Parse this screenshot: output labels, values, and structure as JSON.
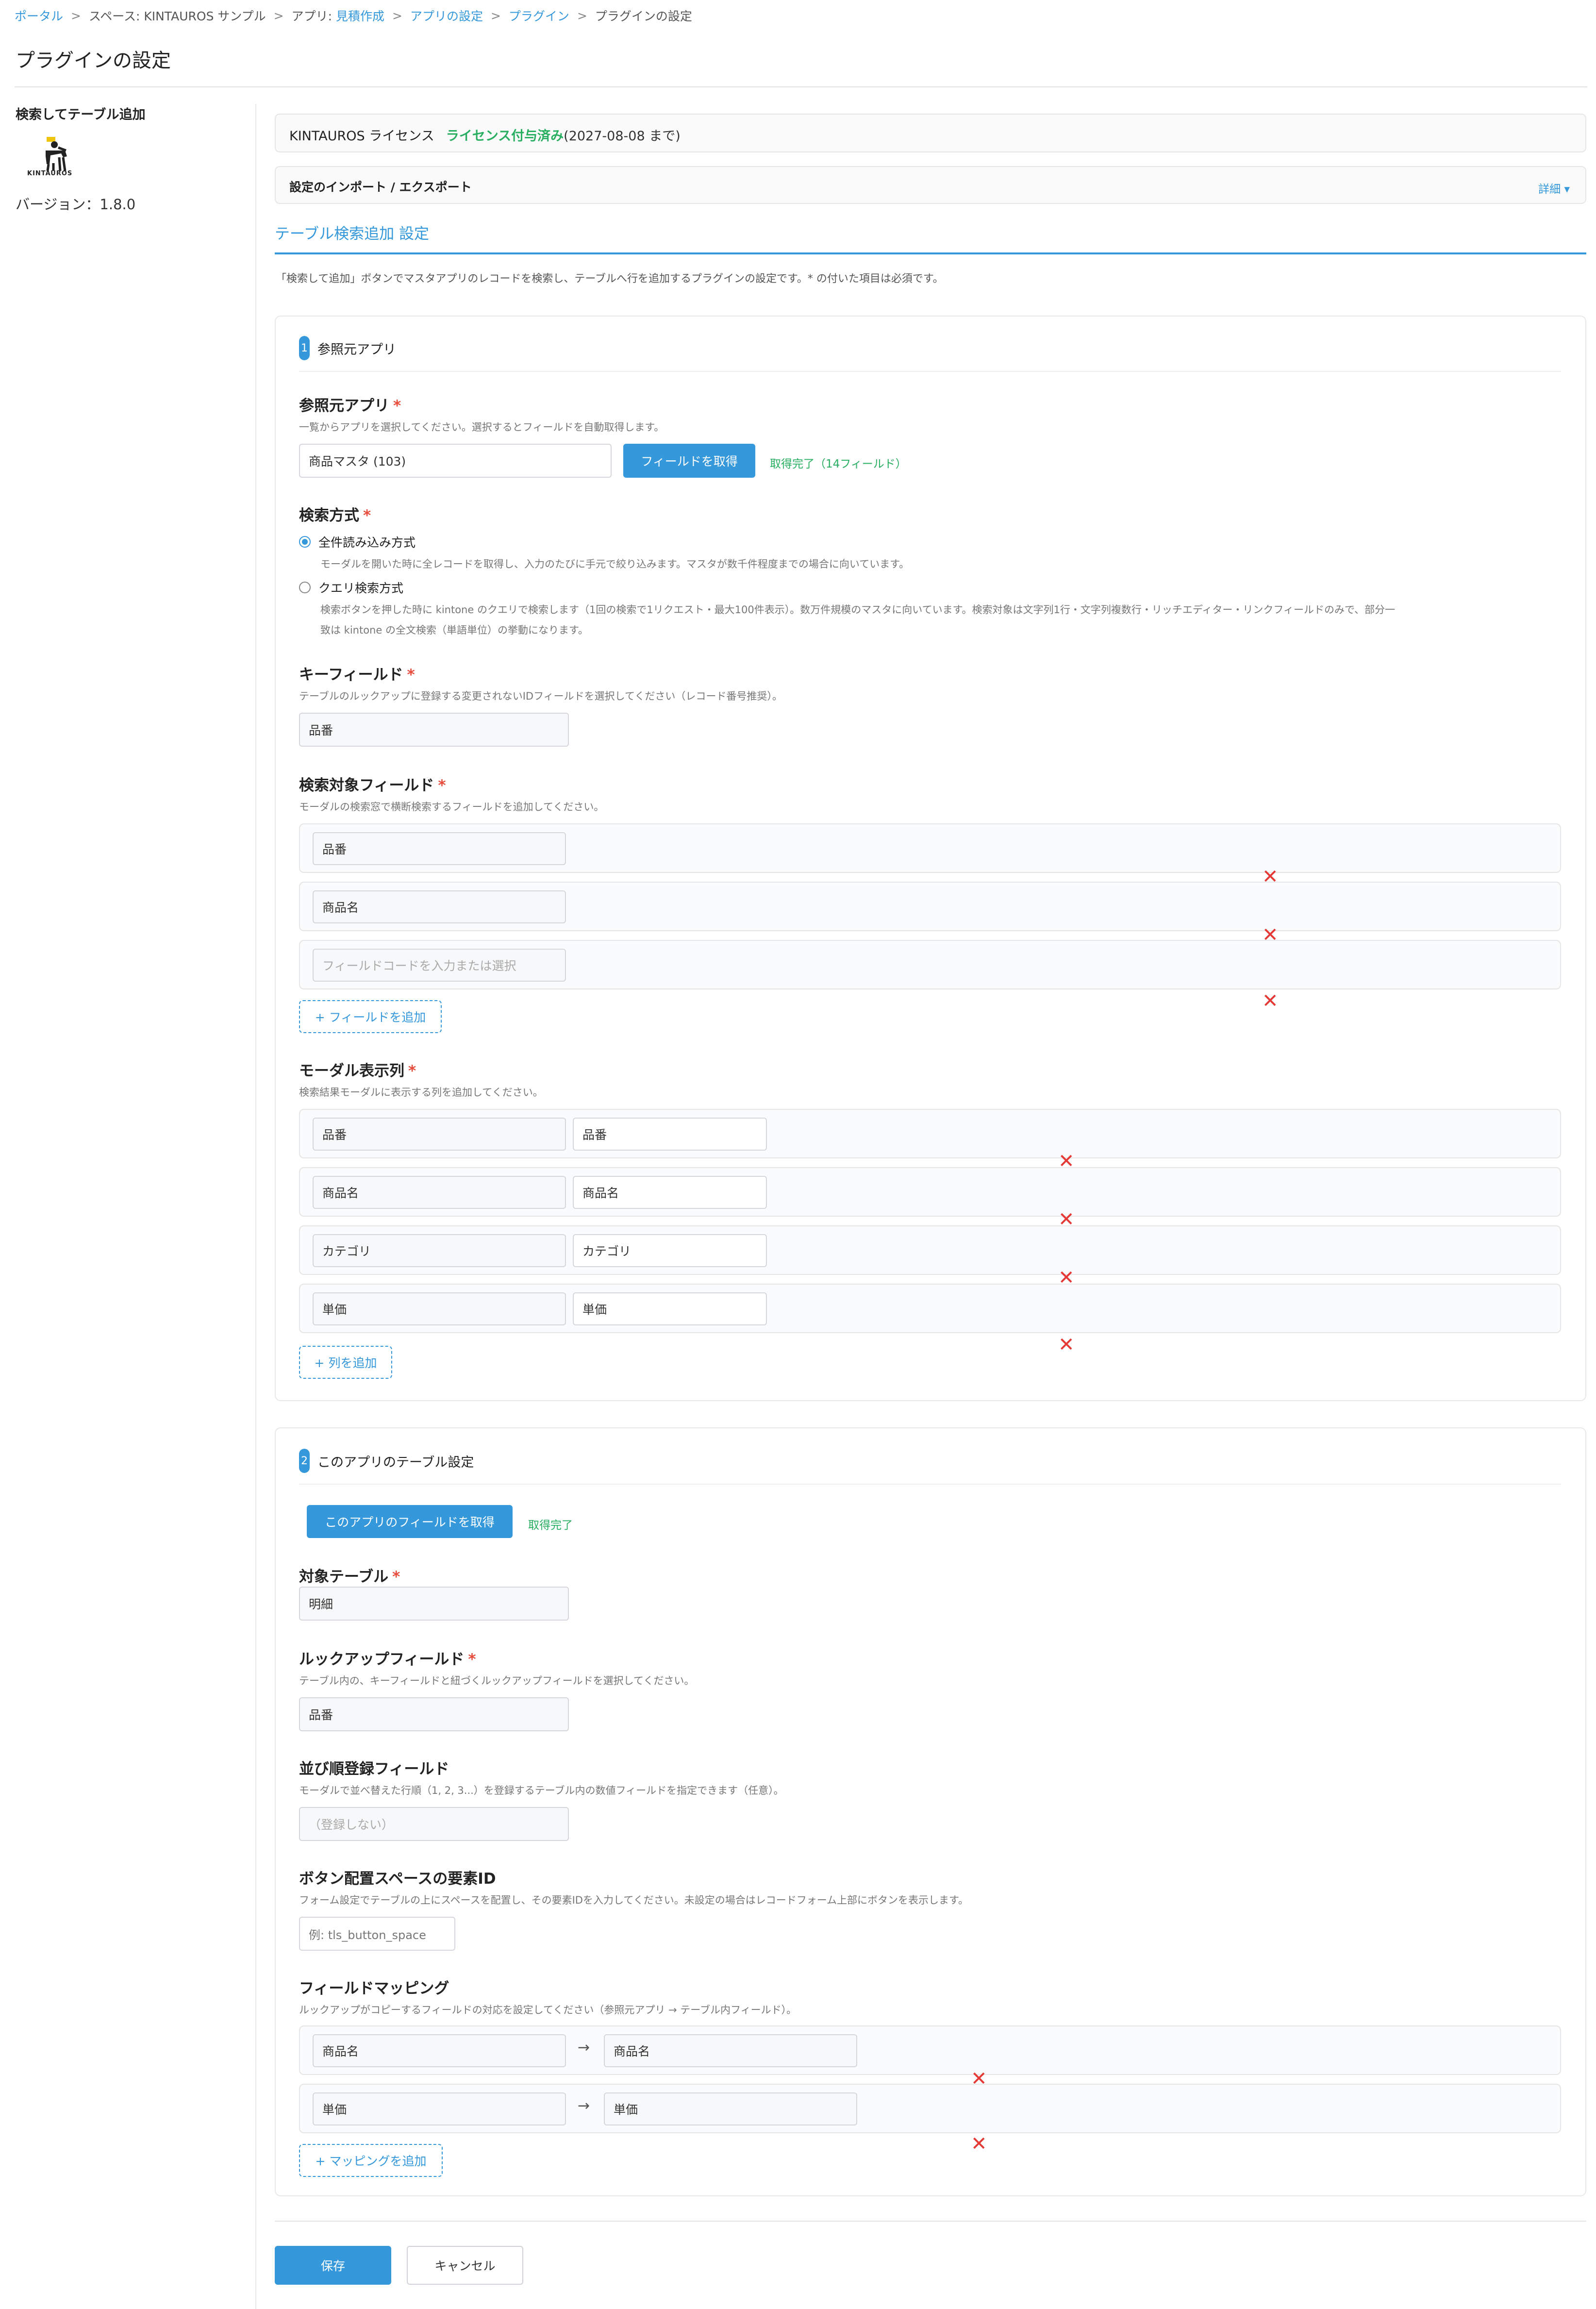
{
  "breadcrumb": {
    "portal": "ポータル",
    "space": "スペース: KINTAUROS サンプル",
    "app_prefix": "アプリ: ",
    "app": "見積作成",
    "app_settings": "アプリの設定",
    "plugins": "プラグイン",
    "current": "プラグインの設定",
    "separator": ">"
  },
  "page_title": "プラグインの設定",
  "sidebar": {
    "plugin_name": "検索してテーブル追加",
    "logo_text": "KINTAUROS",
    "version": "バージョン：1.8.0"
  },
  "license": {
    "title": "KINTAUROS ライセンス",
    "status": "ライセンス付与済み",
    "expiry": "(2027-08-08 まで)"
  },
  "import_export": {
    "title": "設定のインポート / エクスポート",
    "detail": "詳細 ▾"
  },
  "section": {
    "title": "テーブル検索追加 設定",
    "description": "「検索して追加」ボタンでマスタアプリのレコードを検索し、テーブルへ行を追加するプラグインの設定です。* の付いた項目は必須です。"
  },
  "step1": {
    "number": "1",
    "title": "参照元アプリ",
    "source_app": {
      "label": "参照元アプリ",
      "help": "一覧からアプリを選択してください。選択するとフィールドを自動取得します。",
      "value": "商品マスタ (103)",
      "fetch_button": "フィールドを取得",
      "status": "取得完了（14フィールド）"
    },
    "search_method": {
      "label": "検索方式",
      "options": [
        {
          "label": "全件読み込み方式",
          "desc": "モーダルを開いた時に全レコードを取得し、入力のたびに手元で絞り込みます。マスタが数千件程度までの場合に向いています。"
        },
        {
          "label": "クエリ検索方式",
          "desc1": "検索ボタンを押した時に kintone のクエリで検索します（1回の検索で1リクエスト・最大100件表示）。数万件規模のマスタに向いています。検索対象は文字列1行・文字列複数行・リッチエディター・リンクフィールドのみで、部分一",
          "desc2": "致は kintone の全文検索（単語単位）の挙動になります。"
        }
      ]
    },
    "key_field": {
      "label": "キーフィールド",
      "help": "テーブルのルックアップに登録する変更されないIDフィールドを選択してください（レコード番号推奨）。",
      "value": "品番"
    },
    "search_fields": {
      "label": "検索対象フィールド",
      "help": "モーダルの検索窓で横断検索するフィールドを追加してください。",
      "values": [
        "品番",
        "商品名"
      ],
      "placeholder": "フィールドコードを入力または選択",
      "add_button": "+ フィールドを追加"
    },
    "modal_columns": {
      "label": "モーダル表示列",
      "help": "検索結果モーダルに表示する列を追加してください。",
      "rows": [
        {
          "field": "品番",
          "label": "品番"
        },
        {
          "field": "商品名",
          "label": "商品名"
        },
        {
          "field": "カテゴリ",
          "label": "カテゴリ"
        },
        {
          "field": "単価",
          "label": "単価"
        }
      ],
      "add_button": "+ 列を追加"
    }
  },
  "step2": {
    "number": "2",
    "title": "このアプリのテーブル設定",
    "fetch_button": "このアプリのフィールドを取得",
    "status": "取得完了",
    "target_table": {
      "label": "対象テーブル",
      "value": "明細"
    },
    "lookup_field": {
      "label": "ルックアップフィールド",
      "help": "テーブル内の、キーフィールドと紐づくルックアップフィールドを選択してください。",
      "value": "品番"
    },
    "sort_field": {
      "label": "並び順登録フィールド",
      "help": "モーダルで並べ替えた行順（1, 2, 3...）を登録するテーブル内の数値フィールドを指定できます（任意）。",
      "placeholder": "（登録しない）"
    },
    "space_id": {
      "label": "ボタン配置スペースの要素ID",
      "help": "フォーム設定でテーブルの上にスペースを配置し、その要素IDを入力してください。未設定の場合はレコードフォーム上部にボタンを表示します。",
      "placeholder": "例: tls_button_space"
    },
    "field_mapping": {
      "label": "フィールドマッピング",
      "help": "ルックアップがコピーするフィールドの対応を設定してください（参照元アプリ → テーブル内フィールド）。",
      "rows": [
        {
          "source": "商品名",
          "target": "商品名"
        },
        {
          "source": "単価",
          "target": "単価"
        }
      ],
      "arrow": "→",
      "add_button": "+ マッピングを追加"
    }
  },
  "footer": {
    "save": "保存",
    "cancel": "キャンセル"
  },
  "required_mark": "*",
  "remove_mark": "✕"
}
